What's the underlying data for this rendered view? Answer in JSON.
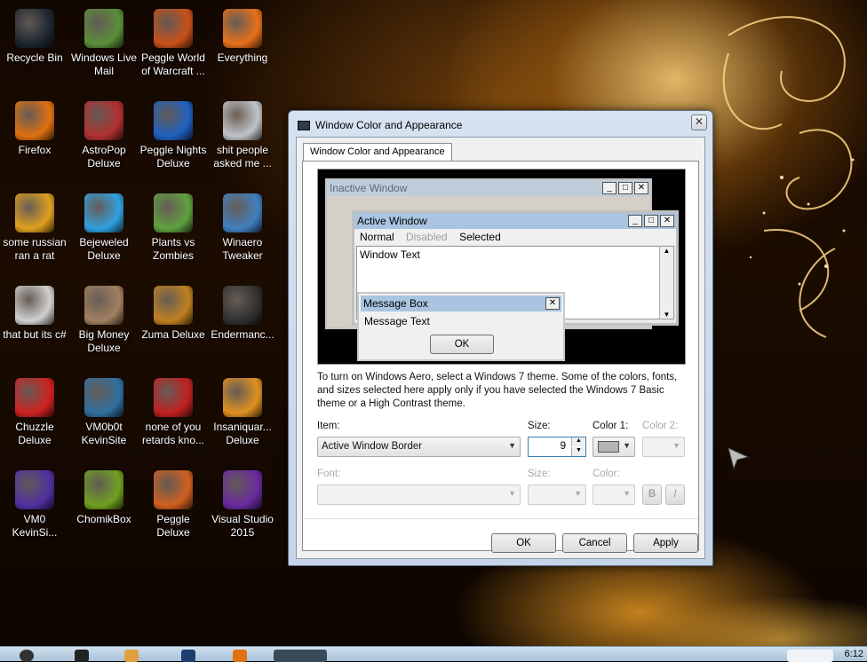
{
  "desktop": {
    "icons": [
      {
        "label": "Recycle Bin",
        "icon": "recycle-bin-icon",
        "color": "#1d2530"
      },
      {
        "label": "Windows Live Mail",
        "icon": "mail-icon",
        "color": "#5b8f3a"
      },
      {
        "label": "Peggle World of Warcraft ...",
        "icon": "peggle-icon",
        "color": "#c8501a"
      },
      {
        "label": "Everything",
        "icon": "search-icon",
        "color": "#e8701a"
      },
      {
        "label": "Firefox",
        "icon": "firefox-icon",
        "color": "#e07010"
      },
      {
        "label": "AstroPop Deluxe",
        "icon": "astropop-icon",
        "color": "#b03030"
      },
      {
        "label": "Peggle Nights Deluxe",
        "icon": "peggle-icon",
        "color": "#2060c0"
      },
      {
        "label": "shit people asked me ...",
        "icon": "folder-icon",
        "color": "#c0c4c8"
      },
      {
        "label": "some russian ran a rat",
        "icon": "app-icon",
        "color": "#e0a020"
      },
      {
        "label": "Bejeweled Deluxe",
        "icon": "bejeweled-icon",
        "color": "#30a0e0"
      },
      {
        "label": "Plants vs Zombies",
        "icon": "plants-icon",
        "color": "#60a040"
      },
      {
        "label": "Winaero Tweaker",
        "icon": "tweaker-icon",
        "color": "#4080c0"
      },
      {
        "label": "that but its c#",
        "icon": "shortcut-icon",
        "color": "#d0d0d0"
      },
      {
        "label": "Big Money Deluxe",
        "icon": "bigmoney-icon",
        "color": "#a08060"
      },
      {
        "label": "Zuma Deluxe",
        "icon": "zuma-icon",
        "color": "#c08020"
      },
      {
        "label": "Endermanc...",
        "icon": "terminal-icon",
        "color": "#303030"
      },
      {
        "label": "Chuzzle Deluxe",
        "icon": "chuzzle-icon",
        "color": "#d02020"
      },
      {
        "label": "VM0b0t KevinSite",
        "icon": "vm-icon",
        "color": "#3070a0"
      },
      {
        "label": "none of you retards kno...",
        "icon": "game-icon",
        "color": "#c02020"
      },
      {
        "label": "Insaniquar... Deluxe",
        "icon": "fish-icon",
        "color": "#e09020"
      },
      {
        "label": "VM0 KevinSi...",
        "icon": "vm-icon",
        "color": "#5030a0"
      },
      {
        "label": "ChomikBox",
        "icon": "chomikbox-icon",
        "color": "#70a020"
      },
      {
        "label": "Peggle Deluxe",
        "icon": "peggle-icon",
        "color": "#d06020"
      },
      {
        "label": "Visual Studio 2015",
        "icon": "visual-studio-icon",
        "color": "#6a2aa0"
      }
    ]
  },
  "dialog": {
    "title": "Window Color and Appearance",
    "close_glyph": "✕",
    "tab_label": "Window Color and Appearance",
    "preview": {
      "inactive_title": "Inactive Window",
      "active_title": "Active Window",
      "menu_normal": "Normal",
      "menu_disabled": "Disabled",
      "menu_selected": "Selected",
      "window_text": "Window Text",
      "msgbox_title": "Message Box",
      "msgbox_text": "Message Text",
      "msgbox_ok": "OK"
    },
    "info_text": "To turn on Windows Aero, select a Windows 7 theme.  Some of the colors, fonts, and sizes selected here apply only if you have selected the Windows 7 Basic theme or a High Contrast theme.",
    "item_label": "Item:",
    "item_value": "Active Window Border",
    "size_label": "Size:",
    "size_value": "9",
    "color1_label": "Color 1:",
    "color2_label": "Color 2:",
    "font_label": "Font:",
    "font_size_label": "Size:",
    "font_color_label": "Color:",
    "bold_label": "B",
    "italic_label": "I",
    "ok_label": "OK",
    "cancel_label": "Cancel",
    "apply_label": "Apply",
    "color1_swatch": "#b4b4b4"
  },
  "taskbar": {
    "clock": "6:12"
  },
  "colors": {
    "accent_title_active": "#a8c4e0",
    "accent_title_inactive": "#bfcddb",
    "selected_menu": "#3399ff"
  }
}
